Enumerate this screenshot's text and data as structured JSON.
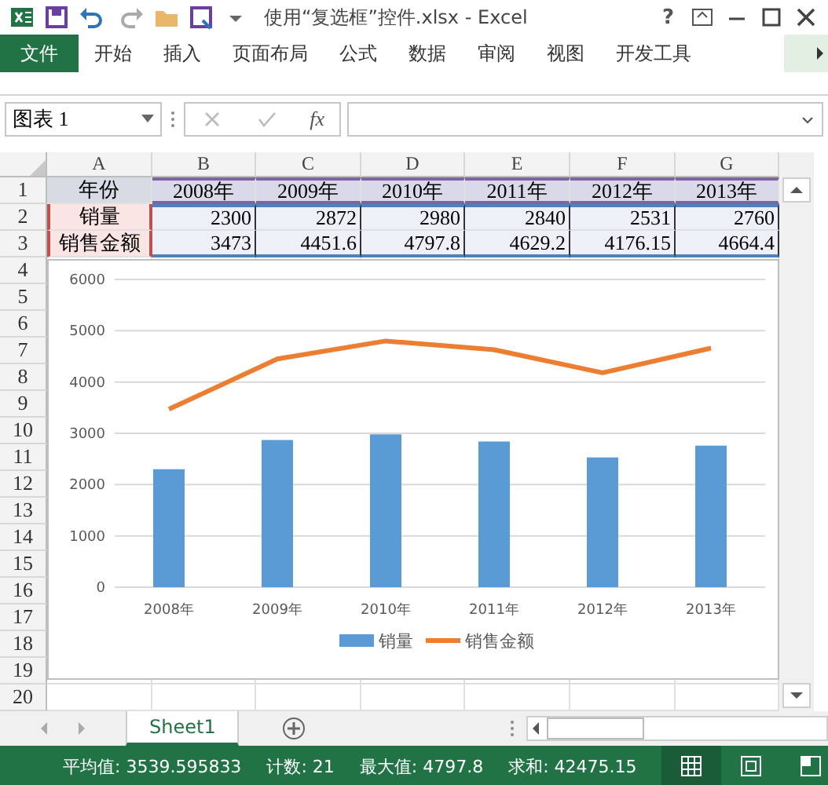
{
  "title_bar": {
    "title": "使用“复选框”控件.xlsx - Excel",
    "help": "?"
  },
  "ribbon_tabs": [
    {
      "label": "文件",
      "kind": "file"
    },
    {
      "label": "开始",
      "kind": "tab"
    },
    {
      "label": "插入",
      "kind": "tab"
    },
    {
      "label": "页面布局",
      "kind": "tab"
    },
    {
      "label": "公式",
      "kind": "tab"
    },
    {
      "label": "数据",
      "kind": "tab"
    },
    {
      "label": "审阅",
      "kind": "tab"
    },
    {
      "label": "视图",
      "kind": "tab"
    },
    {
      "label": "开发工具",
      "kind": "tab"
    }
  ],
  "formula_bar": {
    "name_box": "图表 1",
    "function_label": "fx"
  },
  "columns": [
    "A",
    "B",
    "C",
    "D",
    "E",
    "F",
    "G"
  ],
  "rows": [
    {
      "number": "1",
      "cells": [
        "年份",
        "2008年",
        "2009年",
        "2010年",
        "2011年",
        "2012年",
        "2013年"
      ]
    },
    {
      "number": "2",
      "cells": [
        "销量",
        "2300",
        "2872",
        "2980",
        "2840",
        "2531",
        "2760"
      ]
    },
    {
      "number": "3",
      "cells": [
        "销售金额",
        "3473",
        "4451.6",
        "4797.8",
        "4629.2",
        "4176.15",
        "4664.4"
      ]
    },
    {
      "number": "4",
      "cells": []
    },
    {
      "number": "5",
      "cells": []
    },
    {
      "number": "6",
      "cells": []
    },
    {
      "number": "7",
      "cells": []
    },
    {
      "number": "8",
      "cells": []
    },
    {
      "number": "9",
      "cells": []
    },
    {
      "number": "10",
      "cells": []
    },
    {
      "number": "11",
      "cells": []
    },
    {
      "number": "12",
      "cells": []
    },
    {
      "number": "13",
      "cells": []
    },
    {
      "number": "14",
      "cells": []
    },
    {
      "number": "15",
      "cells": []
    },
    {
      "number": "16",
      "cells": []
    },
    {
      "number": "17",
      "cells": []
    },
    {
      "number": "18",
      "cells": []
    },
    {
      "number": "19",
      "cells": []
    },
    {
      "number": "20",
      "cells": []
    }
  ],
  "chart": {
    "chart_data": {
      "type": "bar",
      "categories": [
        "2008年",
        "2009年",
        "2010年",
        "2011年",
        "2012年",
        "2013年"
      ],
      "series": [
        {
          "name": "销量",
          "type": "bar",
          "color": "#5b9bd5",
          "values": [
            2300,
            2870,
            2980,
            2840,
            2530,
            2760
          ]
        },
        {
          "name": "销售金额",
          "type": "line",
          "color": "#ed7d31",
          "values": [
            3470,
            4450,
            4800,
            4630,
            4180,
            4660
          ]
        }
      ],
      "stacked": false,
      "grid": true,
      "legend": true,
      "ylim": [
        0,
        6000
      ],
      "yticks": [
        0,
        1000,
        2000,
        3000,
        4000,
        5000,
        6000
      ]
    }
  },
  "sheet_tabs": [
    {
      "label": "Sheet1",
      "selected": true
    }
  ],
  "status_bar": {
    "items": [
      "平均值: 3539.595833",
      "计数: 21",
      "最大值: 4797.8",
      "求和: 42475.15"
    ],
    "views": [
      {
        "kind": "normal",
        "selected": true
      },
      {
        "kind": "layout",
        "selected": false
      },
      {
        "kind": "break",
        "selected": false
      }
    ]
  }
}
